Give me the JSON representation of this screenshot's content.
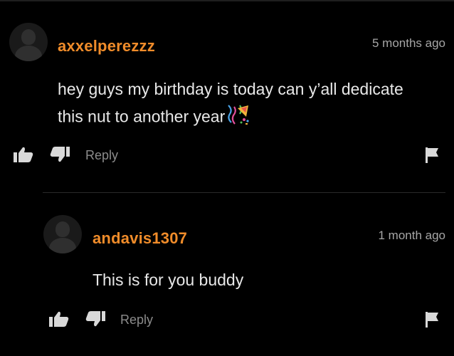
{
  "comments": [
    {
      "username": "axxelperezzz",
      "time": "5 months ago",
      "text_line1": "hey guys my birthday is today can y’all dedicate",
      "text_line2": "this nut to another year",
      "reply_label": "Reply"
    },
    {
      "username": "andavis1307",
      "time": "1 month ago",
      "text_line1": "This is for you buddy",
      "reply_label": "Reply"
    }
  ],
  "colors": {
    "background": "#000000",
    "username": "#f08c2a",
    "text": "#e8e8e8",
    "muted": "#a6a6a6"
  },
  "icons": [
    "thumbs-up-icon",
    "thumbs-down-icon",
    "flag-icon",
    "party-emoji-icon"
  ]
}
